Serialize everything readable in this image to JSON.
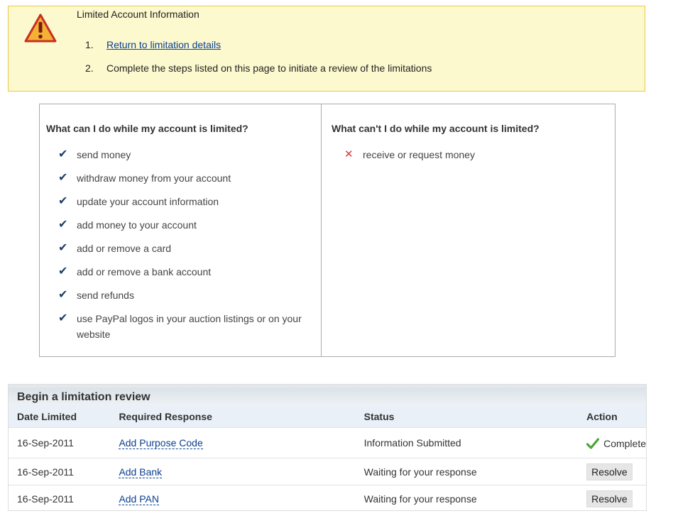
{
  "alert": {
    "title": "Limited Account Information",
    "steps": [
      {
        "num": "1.",
        "text": "Return to limitation details"
      },
      {
        "num": "2.",
        "text": "Complete the steps listed on this page to initiate a review of the limitations"
      }
    ]
  },
  "can": {
    "heading": "What can I do while my account is limited?",
    "items": [
      "send money",
      "withdraw money from your account",
      "update your account information",
      "add money to your account",
      "add or remove a card",
      "add or remove a bank account",
      "send refunds",
      "use PayPal logos in your auction listings or on your website"
    ]
  },
  "cannot": {
    "heading": "What can't I do while my account is limited?",
    "items": [
      "receive or request money"
    ]
  },
  "review": {
    "title": "Begin a limitation review",
    "columns": [
      "Date Limited",
      "Required Response",
      "Status",
      "Action"
    ],
    "rows": [
      {
        "date": "16-Sep-2011",
        "response": "Add Purpose Code",
        "status": "Information Submitted",
        "action": "Complete"
      },
      {
        "date": "16-Sep-2011",
        "response": "Add Bank",
        "status": "Waiting for your response",
        "action": "Resolve"
      },
      {
        "date": "16-Sep-2011",
        "response": "Add PAN",
        "status": "Waiting for your response",
        "action": "Resolve"
      }
    ]
  },
  "colors": {
    "alert_bg": "#fcf9cf",
    "alert_border": "#e8c94b",
    "link": "#0b3f8f",
    "check": "#1d3f66",
    "cross": "#d43b3b",
    "table_header": "#e9f0f7"
  }
}
